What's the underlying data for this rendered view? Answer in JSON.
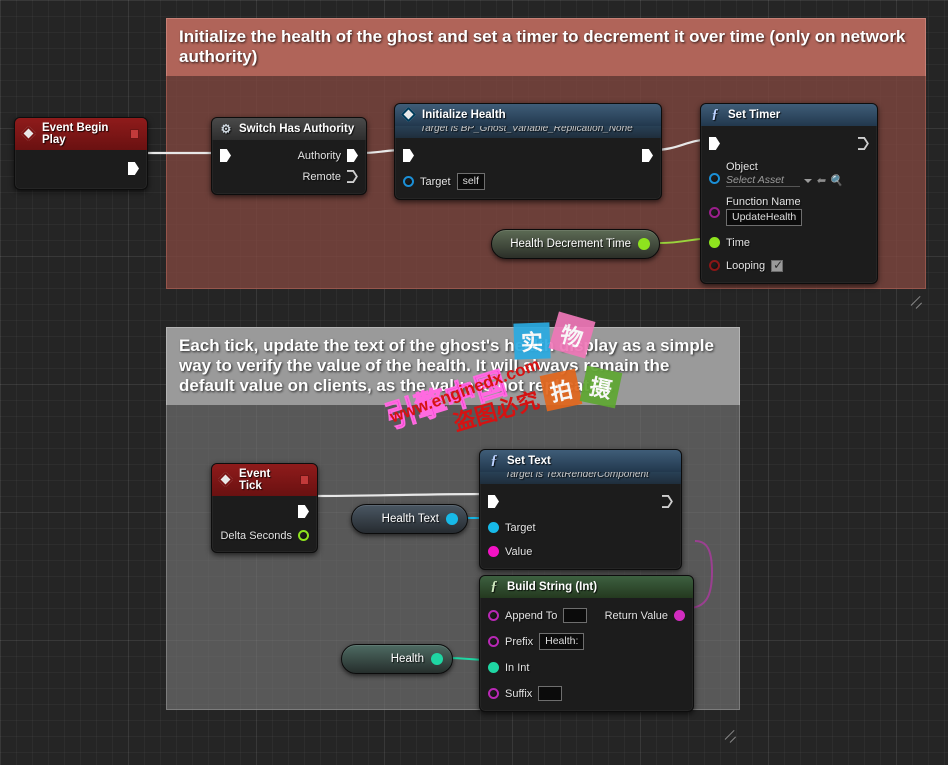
{
  "app": {
    "title": "Unreal Engine Blueprint Graph",
    "canvas_bg": "#252525"
  },
  "comments": [
    {
      "id": "init",
      "text": "Initialize the health of the ghost and set a timer to decrement it over time (only on network authority)",
      "header_color": "#b06459",
      "body_color": "#7e463e"
    },
    {
      "id": "tick",
      "text": "Each tick, update the text of the ghost's health display as a simple way to verify the value of the health. It will always remain the default value on clients, as the value is not replicated.",
      "header_color": "#9a9a9a",
      "body_color": "#787878"
    }
  ],
  "nodes": {
    "event_begin_play": {
      "title": "Event Begin Play",
      "type": "event"
    },
    "switch_has_authority": {
      "title": "Switch Has Authority",
      "type": "gray",
      "outputs": [
        {
          "label": "Authority"
        },
        {
          "label": "Remote"
        }
      ]
    },
    "initialize_health": {
      "title": "Initialize Health",
      "subtitle": "Target is BP_Ghost_Variable_Replication_None",
      "type": "function",
      "inputs": [
        {
          "label": "Target",
          "value": "self",
          "pin": "object"
        }
      ]
    },
    "set_timer": {
      "title": "Set Timer",
      "type": "function",
      "inputs": [
        {
          "label": "Object",
          "value": "Select Asset",
          "pin": "object"
        },
        {
          "label": "Function Name",
          "value": "UpdateHealth",
          "pin": "name"
        },
        {
          "label": "Time",
          "value": "",
          "pin": "float"
        },
        {
          "label": "Looping",
          "value": "checked",
          "pin": "bool"
        }
      ]
    },
    "health_decrement_time": {
      "title": "Health Decrement Time",
      "type": "variable-float"
    },
    "event_tick": {
      "title": "Event Tick",
      "type": "event",
      "outputs": [
        {
          "label": "Delta Seconds"
        }
      ]
    },
    "health_text": {
      "title": "Health Text",
      "type": "variable-object"
    },
    "set_text": {
      "title": "Set Text",
      "subtitle": "Target is TextRenderComponent",
      "type": "function",
      "inputs": [
        {
          "label": "Target",
          "pin": "cyan"
        },
        {
          "label": "Value",
          "pin": "magenta"
        }
      ]
    },
    "build_string_int": {
      "title": "Build String (Int)",
      "type": "pure",
      "inputs": [
        {
          "label": "Append To",
          "value": "",
          "pin": "string"
        },
        {
          "label": "Prefix",
          "value": "Health:",
          "pin": "string"
        },
        {
          "label": "In Int",
          "value": "",
          "pin": "int"
        },
        {
          "label": "Suffix",
          "value": "",
          "pin": "string"
        }
      ],
      "outputs": [
        {
          "label": "Return Value",
          "pin": "string"
        }
      ]
    },
    "health": {
      "title": "Health",
      "type": "variable-int"
    }
  },
  "watermark": {
    "squares": [
      {
        "char": "实",
        "color": "#2aabe2"
      },
      {
        "char": "物",
        "color": "#ef78b8"
      },
      {
        "char": "拍",
        "color": "#e2661c"
      },
      {
        "char": "摄",
        "color": "#5fa832"
      }
    ],
    "brand": "引擎中国",
    "url": "www.enginedx.com",
    "notice": "盗图必究"
  }
}
